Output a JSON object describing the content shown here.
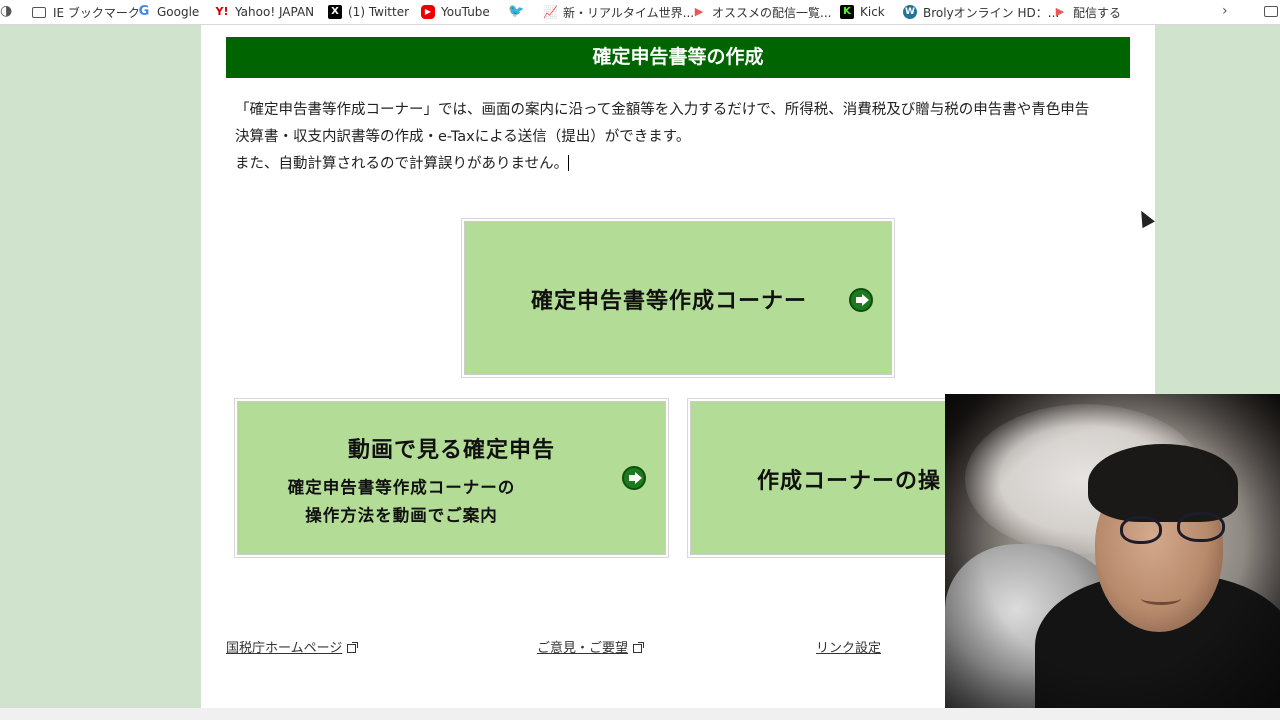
{
  "bookmarks": [
    {
      "label": "IE ブックマーク",
      "icon": "folder-icon"
    },
    {
      "label": "Google",
      "icon": "google-icon"
    },
    {
      "label": "Yahoo! JAPAN",
      "icon": "yahoo-icon"
    },
    {
      "label": "(1) Twitter",
      "icon": "x-icon"
    },
    {
      "label": "YouTube",
      "icon": "youtube-icon"
    },
    {
      "label": "",
      "icon": "twitter-bird-icon"
    },
    {
      "label": "新・リアルタイム世界...",
      "icon": "chart-icon"
    },
    {
      "label": "オススメの配信一覧...",
      "icon": "stream-icon"
    },
    {
      "label": "Kick",
      "icon": "kick-icon"
    },
    {
      "label": "Brolyオンライン HD：...",
      "icon": "wordpress-icon"
    },
    {
      "label": "配信する",
      "icon": "stream-icon"
    }
  ],
  "page": {
    "section_title": "確定申告書等の作成",
    "intro_line1": "「確定申告書等作成コーナー」では、画面の案内に沿って金額等を入力するだけで、所得税、消費税及び贈与税の申告書や青色申告",
    "intro_line2": "決算書・収支内訳書等の作成・e-Taxによる送信（提出）ができます。",
    "intro_line3": "また、自動計算されるので計算誤りがありません。",
    "main_button": "確定申告書等作成コーナー",
    "video_button_title": "動画で見る確定申告",
    "video_button_sub1": "確定申告書等作成コーナーの",
    "video_button_sub2": "操作方法を動画でご案内",
    "ops_button": "作成コーナーの操",
    "footer_links": [
      "国税庁ホームページ",
      "ご意見・ご要望",
      "リンク設定"
    ]
  },
  "colors": {
    "header_green": "#006400",
    "button_green": "#b3dc96",
    "background_green": "#cfe3cd",
    "arrow_green": "#1e7a1e"
  }
}
